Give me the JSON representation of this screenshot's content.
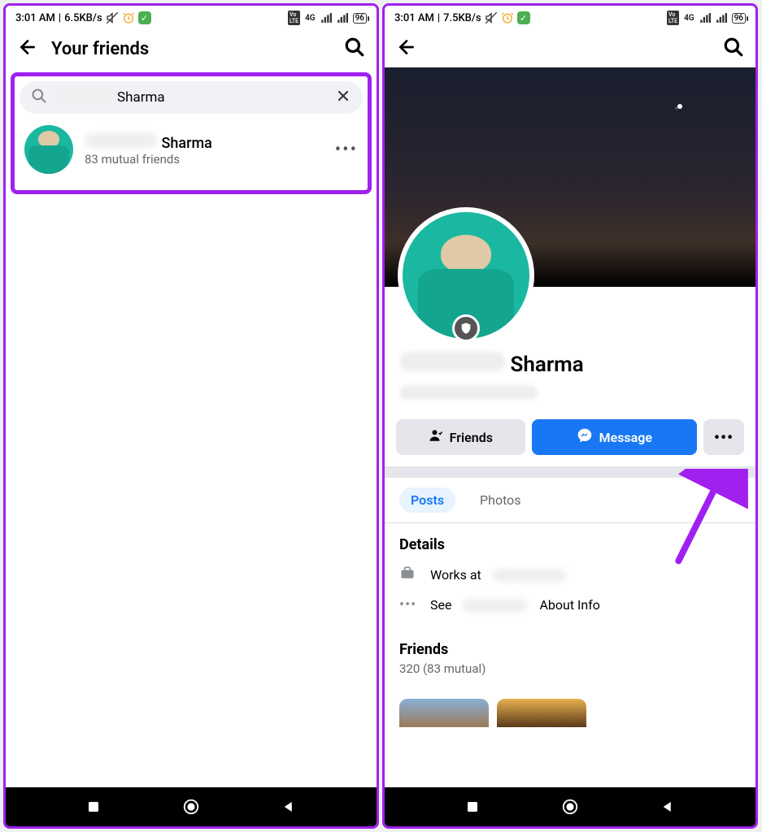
{
  "left": {
    "status": {
      "time": "3:01 AM",
      "rate": "6.5KB/s",
      "net": "4G",
      "battery": "96"
    },
    "header": {
      "title": "Your friends"
    },
    "search": {
      "value": "Sharma"
    },
    "result": {
      "name": "Sharma",
      "mutual": "83 mutual friends"
    }
  },
  "right": {
    "status": {
      "time": "3:01 AM",
      "rate": "7.5KB/s",
      "net": "4G",
      "battery": "96"
    },
    "profile": {
      "name_visible": "Sharma"
    },
    "actions": {
      "friends": "Friends",
      "message": "Message"
    },
    "tabs": {
      "posts": "Posts",
      "photos": "Photos"
    },
    "details": {
      "heading": "Details",
      "works_at_prefix": "Works at",
      "see_prefix": "See",
      "about_suffix": "About Info"
    },
    "friends_section": {
      "heading": "Friends",
      "sub": "320 (83 mutual)"
    }
  }
}
